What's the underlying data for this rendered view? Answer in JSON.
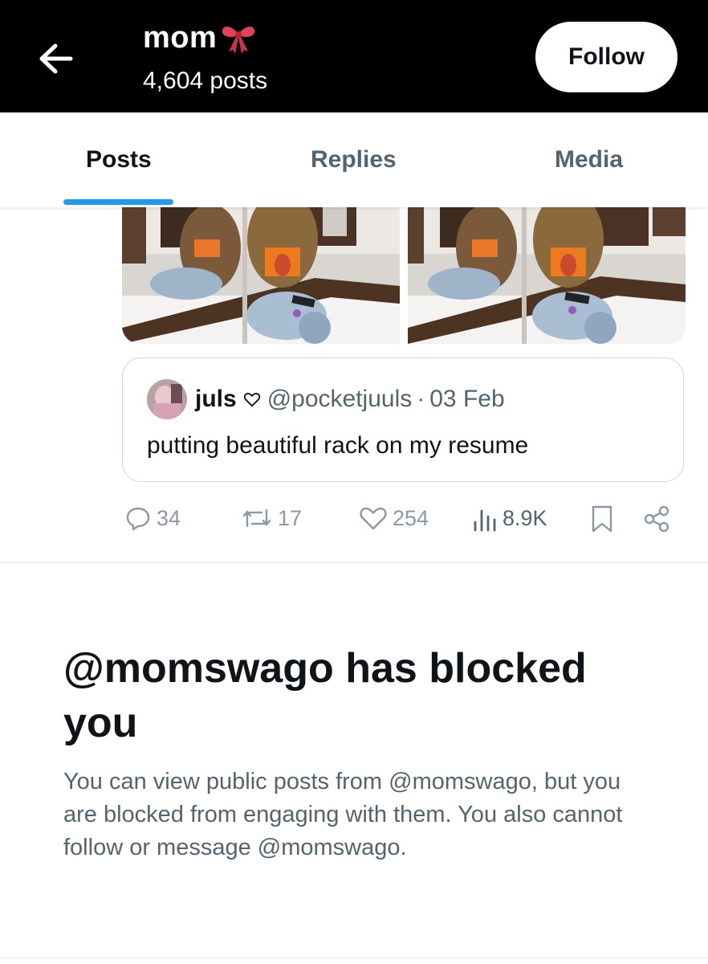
{
  "header": {
    "name": "mom",
    "name_emoji": "ribbon-bow",
    "post_count": "4,604 posts",
    "follow_label": "Follow"
  },
  "tabs": [
    {
      "label": "Posts",
      "active": true
    },
    {
      "label": "Replies",
      "active": false
    },
    {
      "label": "Media",
      "active": false
    }
  ],
  "quoted_post": {
    "author_name": "juls",
    "author_badge": "heart-outline-icon",
    "handle": "@pocketjuuls",
    "separator": "·",
    "date": "03 Feb",
    "text": "putting beautiful rack on my resume"
  },
  "actions": {
    "replies": "34",
    "reposts": "17",
    "likes": "254",
    "views": "8.9K"
  },
  "blocked": {
    "title": "@momswago has blocked you",
    "description": "You can view public posts from @momswago, but you are blocked from engaging with them. You also cannot follow or message @momswago."
  },
  "colors": {
    "accent": "#1d9bf0",
    "header_bg": "#000000",
    "secondary_text": "#536471",
    "border": "#cfd9de"
  }
}
